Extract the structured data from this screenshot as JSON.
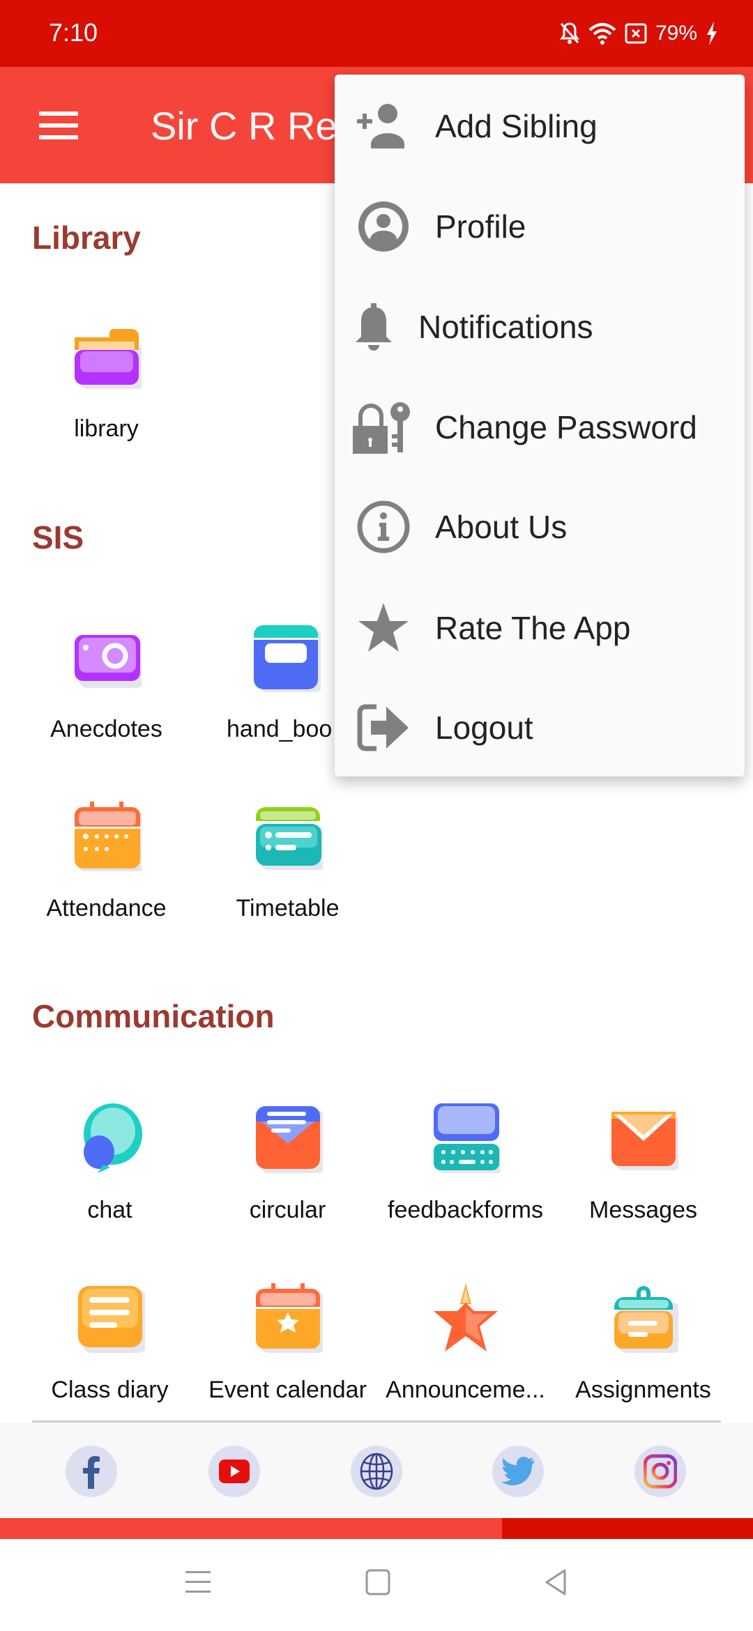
{
  "status_bar": {
    "time": "7:10",
    "battery": "79%"
  },
  "app_bar": {
    "title": "Sir C R Re",
    "menu_icon": "hamburger-icon"
  },
  "sections": [
    {
      "title": "Library",
      "items": [
        {
          "label": "library",
          "icon": "folder-icon"
        }
      ]
    },
    {
      "title": "SIS",
      "items": [
        {
          "label": "Anecdotes",
          "icon": "camera-icon"
        },
        {
          "label": "hand_boo",
          "icon": "handbook-icon"
        },
        {
          "label": "Attendance",
          "icon": "calendar-icon"
        },
        {
          "label": "Timetable",
          "icon": "timetable-icon"
        }
      ]
    },
    {
      "title": "Communication",
      "items": [
        {
          "label": "chat",
          "icon": "chat-icon"
        },
        {
          "label": "circular",
          "icon": "circular-icon"
        },
        {
          "label": "feedbackforms",
          "icon": "feedback-icon"
        },
        {
          "label": "Messages",
          "icon": "envelope-icon"
        },
        {
          "label": "Class diary",
          "icon": "diary-icon"
        },
        {
          "label": "Event calendar",
          "icon": "event-calendar-icon"
        },
        {
          "label": "Announceme...",
          "icon": "announcement-icon"
        },
        {
          "label": "Assignments",
          "icon": "clipboard-icon"
        }
      ]
    }
  ],
  "social": [
    {
      "name": "facebook",
      "icon": "facebook-icon"
    },
    {
      "name": "youtube",
      "icon": "youtube-icon"
    },
    {
      "name": "website",
      "icon": "globe-icon"
    },
    {
      "name": "twitter",
      "icon": "twitter-icon"
    },
    {
      "name": "instagram",
      "icon": "instagram-icon"
    }
  ],
  "overflow_menu": {
    "items": [
      {
        "label": "Add Sibling",
        "icon": "add-person-icon"
      },
      {
        "label": "Profile",
        "icon": "profile-icon"
      },
      {
        "label": "Notifications",
        "icon": "bell-icon"
      },
      {
        "label": "Change Password",
        "icon": "lock-key-icon"
      },
      {
        "label": "About Us",
        "icon": "info-icon"
      },
      {
        "label": "Rate The App",
        "icon": "star-icon"
      },
      {
        "label": "Logout",
        "icon": "logout-icon"
      }
    ]
  },
  "nav_bar": {
    "buttons": [
      "recents",
      "home",
      "back"
    ]
  },
  "colors": {
    "status_bar": "#d80e02",
    "app_bar": "#f5453a",
    "section_title": "#9c3a30",
    "menu_icon": "#808080"
  }
}
